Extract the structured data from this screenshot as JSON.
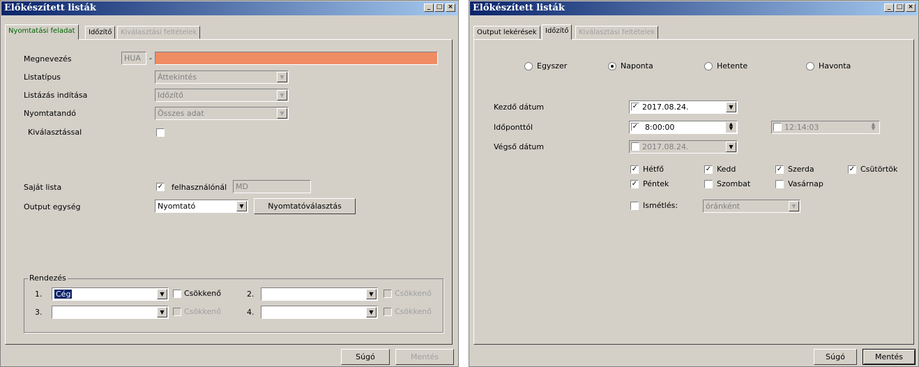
{
  "left_window": {
    "title": "Előkészített listák",
    "tabs": [
      "Nyomtatási feladat",
      "Időzítő",
      "Kiválasztási feltételek"
    ],
    "fields": {
      "megnevezes_label": "Megnevezés",
      "megnevezes_prefix": "HUA",
      "megnevezes_dash": "-",
      "listatipus_label": "Listatípus",
      "listatipus_value": "Áttekintés",
      "listazas_label": "Listázás indítása",
      "listazas_value": "Időzítő",
      "nyomtatando_label": "Nyomtatandó",
      "nyomtatando_value": "Összes adat",
      "kivalasztassal_label": "Kiválasztással",
      "sajat_lista_label": "Saját lista",
      "felhasznalonal_label": "felhasználónál",
      "felhasznalonal_value": "MD",
      "output_egyseg_label": "Output egység",
      "output_egyseg_value": "Nyomtató",
      "nyomtatovalasztas_button": "Nyomtatóválasztás"
    },
    "rendezes": {
      "label": "Rendezés",
      "rows": [
        {
          "num": "1.",
          "value": "Cég",
          "desc": "Csökkenő"
        },
        {
          "num": "2.",
          "value": "",
          "desc": "Csökkenő"
        },
        {
          "num": "3.",
          "value": "",
          "desc": "Csökkenő"
        },
        {
          "num": "4.",
          "value": "",
          "desc": "Csökkenő"
        }
      ]
    },
    "buttons": {
      "sugo": "Súgó",
      "mentes": "Mentés"
    }
  },
  "right_window": {
    "title": "Előkészített listák",
    "tabs": [
      "Output lekérések",
      "Időzítő",
      "Kiválasztási feltételek"
    ],
    "frequency": {
      "options": [
        "Egyszer",
        "Naponta",
        "Hetente",
        "Havonta"
      ],
      "selected": "Naponta"
    },
    "kezdo_datum_label": "Kezdő dátum",
    "kezdo_datum_value": "2017.08.24.",
    "idoponttol_label": "Időponttól",
    "idoponttol_value": "8:00:00",
    "idopontig_value": "12:14:03",
    "vegso_datum_label": "Végső dátum",
    "vegso_datum_value": "2017.08.24.",
    "days": [
      {
        "name": "Hétfő",
        "checked": true
      },
      {
        "name": "Kedd",
        "checked": true
      },
      {
        "name": "Szerda",
        "checked": true
      },
      {
        "name": "Csütörtök",
        "checked": true
      },
      {
        "name": "Péntek",
        "checked": true
      },
      {
        "name": "Szombat",
        "checked": false
      },
      {
        "name": "Vasárnap",
        "checked": false
      }
    ],
    "ismetles_label": "Ismétlés:",
    "ismetles_value": "óránként",
    "buttons": {
      "sugo": "Súgó",
      "mentes": "Mentés"
    }
  }
}
